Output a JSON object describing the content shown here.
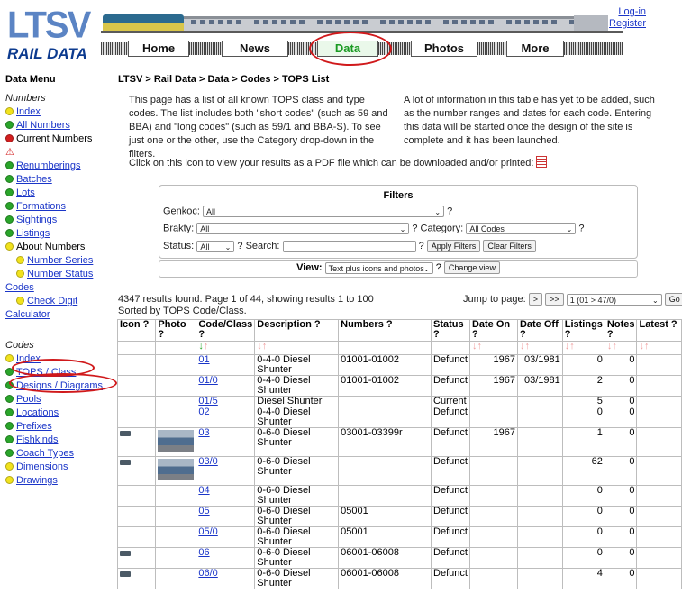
{
  "header": {
    "logo_top": "LTSV",
    "logo_bottom": "RAIL DATA",
    "nav": [
      {
        "label": "Home",
        "active": false
      },
      {
        "label": "News",
        "active": false
      },
      {
        "label": "Data",
        "active": true
      },
      {
        "label": "Photos",
        "active": false
      },
      {
        "label": "More",
        "active": false
      }
    ],
    "login": "Log-in",
    "register": "Register"
  },
  "sidebar": {
    "title": "Data Menu",
    "numbers_heading": "Numbers",
    "numbers_items": [
      {
        "label": "Index",
        "dot": "yellow",
        "link": true
      },
      {
        "label": "All Numbers",
        "dot": "green",
        "link": true
      },
      {
        "label": "Current Numbers",
        "dot": "red",
        "link": false
      },
      {
        "label": "",
        "dot": "warn",
        "link": false
      },
      {
        "label": "Renumberings",
        "dot": "green",
        "link": true
      },
      {
        "label": "Batches",
        "dot": "green",
        "link": true
      },
      {
        "label": "Lots",
        "dot": "green",
        "link": true
      },
      {
        "label": "Formations",
        "dot": "green",
        "link": true
      },
      {
        "label": "Sightings",
        "dot": "green",
        "link": true
      },
      {
        "label": "Listings",
        "dot": "green",
        "link": true
      },
      {
        "label": "About Numbers",
        "dot": "yellow",
        "link": false
      },
      {
        "label": "Number Series",
        "dot": "yellow",
        "link": true,
        "indent": true
      },
      {
        "label": "Number Status",
        "dot": "yellow",
        "link": true,
        "indent": true
      }
    ],
    "codes_link": "Codes",
    "check_digit": "Check Digit",
    "calculator": "Calculator",
    "codes_heading": "Codes",
    "codes_items": [
      {
        "label": "Index",
        "dot": "yellow"
      },
      {
        "label": "TOPS / Class",
        "dot": "green"
      },
      {
        "label": "Designs / Diagrams",
        "dot": "green"
      },
      {
        "label": "Pools",
        "dot": "green"
      },
      {
        "label": "Locations",
        "dot": "green"
      },
      {
        "label": "Prefixes",
        "dot": "green"
      },
      {
        "label": "Fishkinds",
        "dot": "green"
      },
      {
        "label": "Coach Types",
        "dot": "green"
      },
      {
        "label": "Dimensions",
        "dot": "yellow"
      },
      {
        "label": "Drawings",
        "dot": "yellow"
      }
    ]
  },
  "main": {
    "breadcrumb": "LTSV > Rail Data > Data > Codes > TOPS List",
    "intro_left": "This page has a list of all known TOPS class and type codes. The list includes both \"short codes\" (such as 59 and BBA) and \"long codes\" (such as 59/1 and BBA-S). To see just one or the other, use the Category drop-down in the filters.",
    "intro_right": "A lot of information in this table has yet to be added, such as the number ranges and dates for each code. Entering this data will be started once the design of the site is complete and it has been launched.",
    "pdf_text": "Click on this icon to view your results as a PDF file which can be downloaded and/or printed:"
  },
  "filters": {
    "title": "Filters",
    "genkoc_label": "Genkoc:",
    "genkoc_value": "All",
    "brakty_label": "Brakty:",
    "brakty_value": "All",
    "category_label": "Category:",
    "category_value": "All Codes",
    "status_label": "Status:",
    "status_value": "All",
    "search_label": "Search:",
    "search_value": "",
    "apply": "Apply Filters",
    "clear": "Clear Filters",
    "help": "?"
  },
  "view": {
    "label": "View:",
    "value": "Text plus icons and photos",
    "change": "Change view"
  },
  "results": {
    "summary": "4347 results found. Page 1 of 44, showing results 1 to 100",
    "sorted": "Sorted by TOPS Code/Class.",
    "jump_label": "Jump to page:",
    "next": ">",
    "last": ">>",
    "page_value": "1 (01 > 47/0)",
    "go": "Go"
  },
  "table": {
    "headers": [
      "Icon ?",
      "Photo ?",
      "Code/Class ?",
      "Description ?",
      "Numbers ?",
      "Status ?",
      "Date On ?",
      "Date Off ?",
      "Listings ?",
      "Notes ?",
      "Latest ?"
    ],
    "rows": [
      {
        "icon": false,
        "photo": false,
        "code": "01",
        "desc": "0-4-0 Diesel Shunter",
        "numbers": "01001-01002",
        "status": "Defunct",
        "on": "1967",
        "off": "03/1981",
        "listings": "0",
        "notes": "0"
      },
      {
        "icon": false,
        "photo": false,
        "code": "01/0",
        "desc": "0-4-0 Diesel Shunter",
        "numbers": "01001-01002",
        "status": "Defunct",
        "on": "1967",
        "off": "03/1981",
        "listings": "2",
        "notes": "0"
      },
      {
        "icon": false,
        "photo": false,
        "code": "01/5",
        "desc": "Diesel Shunter",
        "numbers": "",
        "status": "Current",
        "on": "",
        "off": "",
        "listings": "5",
        "notes": "0"
      },
      {
        "icon": false,
        "photo": false,
        "code": "02",
        "desc": "0-4-0 Diesel Shunter",
        "numbers": "",
        "status": "Defunct",
        "on": "",
        "off": "",
        "listings": "0",
        "notes": "0"
      },
      {
        "icon": true,
        "photo": true,
        "code": "03",
        "desc": "0-6-0 Diesel Shunter",
        "numbers": "03001-03399r",
        "status": "Defunct",
        "on": "1967",
        "off": "",
        "listings": "1",
        "notes": "0"
      },
      {
        "icon": true,
        "photo": true,
        "code": "03/0",
        "desc": "0-6-0 Diesel Shunter",
        "numbers": "",
        "status": "Defunct",
        "on": "",
        "off": "",
        "listings": "62",
        "notes": "0"
      },
      {
        "icon": false,
        "photo": false,
        "code": "04",
        "desc": "0-6-0 Diesel Shunter",
        "numbers": "",
        "status": "Defunct",
        "on": "",
        "off": "",
        "listings": "0",
        "notes": "0"
      },
      {
        "icon": false,
        "photo": false,
        "code": "05",
        "desc": "0-6-0 Diesel Shunter",
        "numbers": "05001",
        "status": "Defunct",
        "on": "",
        "off": "",
        "listings": "0",
        "notes": "0"
      },
      {
        "icon": false,
        "photo": false,
        "code": "05/0",
        "desc": "0-6-0 Diesel Shunter",
        "numbers": "05001",
        "status": "Defunct",
        "on": "",
        "off": "",
        "listings": "0",
        "notes": "0"
      },
      {
        "icon": true,
        "photo": false,
        "code": "06",
        "desc": "0-6-0 Diesel Shunter",
        "numbers": "06001-06008",
        "status": "Defunct",
        "on": "",
        "off": "",
        "listings": "0",
        "notes": "0"
      },
      {
        "icon": true,
        "photo": false,
        "code": "06/0",
        "desc": "0-6-0 Diesel Shunter",
        "numbers": "06001-06008",
        "status": "Defunct",
        "on": "",
        "off": "",
        "listings": "4",
        "notes": "0"
      }
    ]
  }
}
